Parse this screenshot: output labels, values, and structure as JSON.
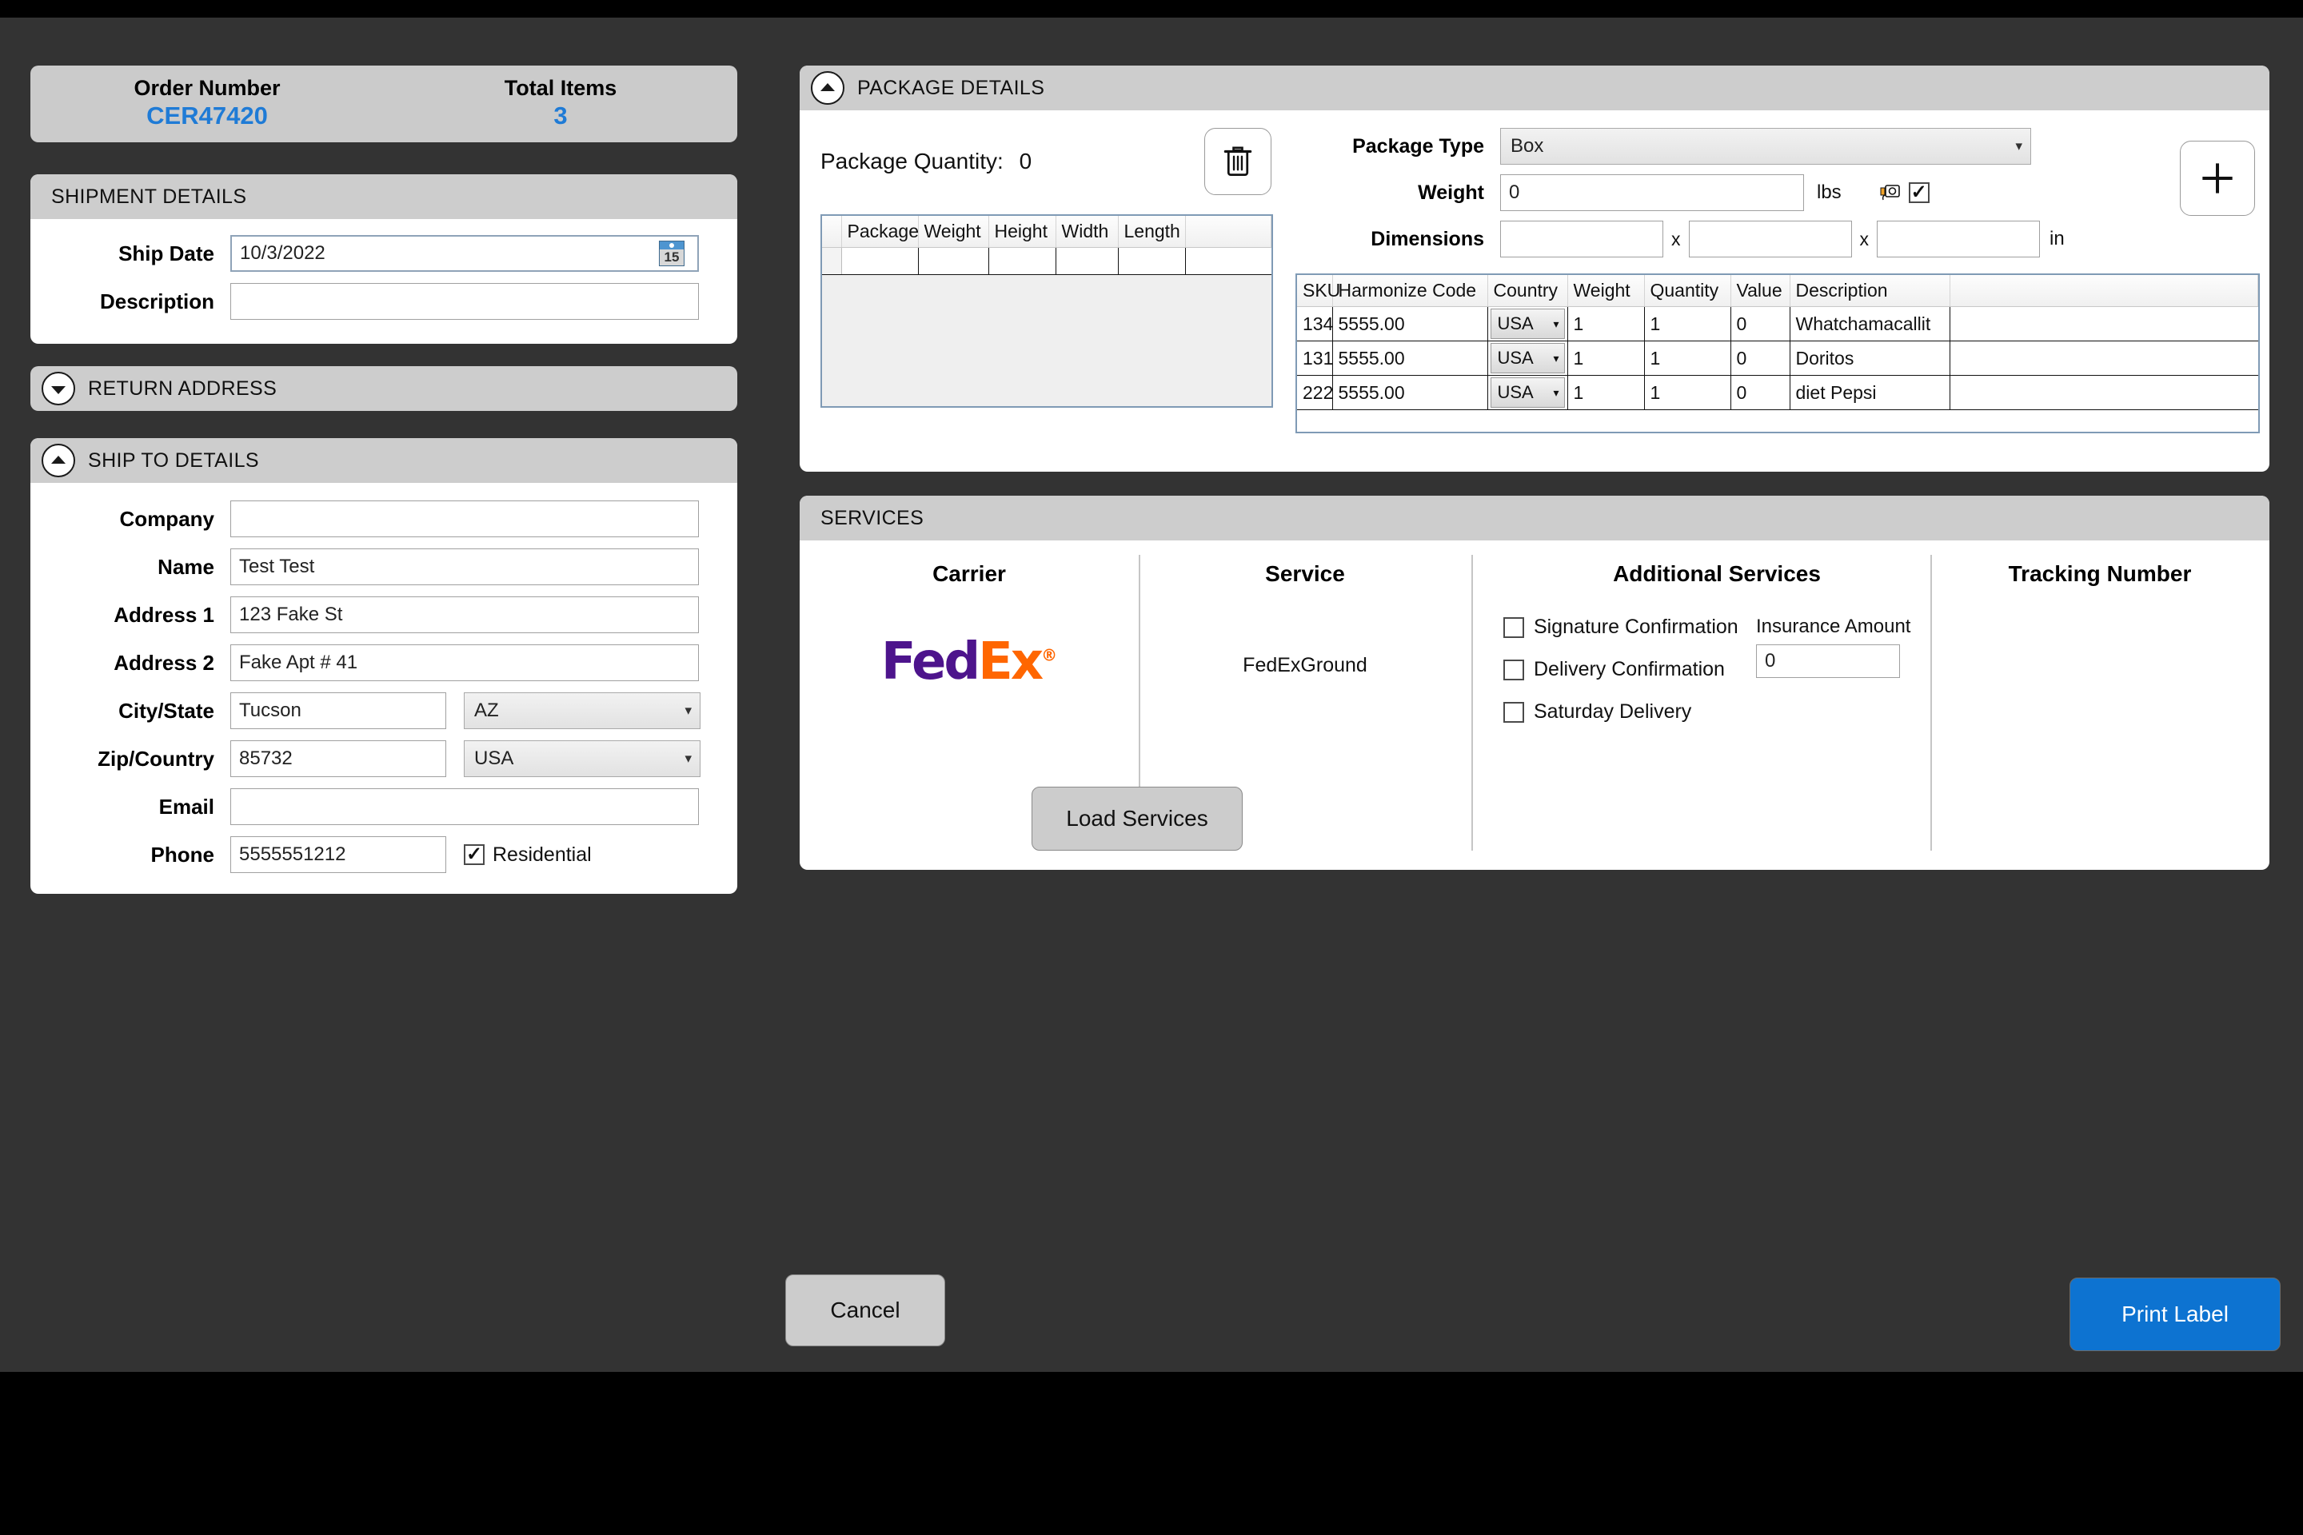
{
  "order_header": {
    "order_number_label": "Order Number",
    "order_number_value": "CER47420",
    "total_items_label": "Total Items",
    "total_items_value": "3",
    "accent_color": "#1f7bd6"
  },
  "shipment_details": {
    "title": "SHIPMENT DETAILS",
    "ship_date_label": "Ship Date",
    "ship_date_value": "10/3/2022",
    "calendar_day": "15",
    "description_label": "Description",
    "description_value": ""
  },
  "return_address": {
    "title": "RETURN ADDRESS",
    "collapsed": true
  },
  "ship_to": {
    "title": "SHIP TO DETAILS",
    "company_label": "Company",
    "company_value": "",
    "name_label": "Name",
    "name_value": "Test Test",
    "address1_label": "Address 1",
    "address1_value": "123 Fake St",
    "address2_label": "Address 2",
    "address2_value": "Fake Apt # 41",
    "city_state_label": "City/State",
    "city_value": "Tucson",
    "state_value": "AZ",
    "zip_country_label": "Zip/Country",
    "zip_value": "85732",
    "country_value": "USA",
    "email_label": "Email",
    "email_value": "",
    "phone_label": "Phone",
    "phone_value": "5555551212",
    "residential_label": "Residential",
    "residential_checked": true
  },
  "package_details": {
    "title": "PACKAGE DETAILS",
    "package_quantity_label": "Package Quantity:",
    "package_quantity_value": "0",
    "delete_icon": "trash-icon",
    "add_icon": "plus-icon",
    "package_table": {
      "columns": [
        "Package",
        "Weight",
        "Height",
        "Width",
        "Length",
        ""
      ],
      "rows": [
        [
          "",
          "",
          "",
          "",
          "",
          ""
        ]
      ]
    },
    "package_type_label": "Package Type",
    "package_type_value": "Box",
    "weight_label": "Weight",
    "weight_value": "0",
    "weight_unit": "lbs",
    "scale_icon": "scale-icon",
    "scale_checked": true,
    "dimensions_label": "Dimensions",
    "dim_length": "",
    "dim_width": "",
    "dim_height": "",
    "dim_separator": "x",
    "dim_unit": "in",
    "sku_table": {
      "columns": [
        "SKU",
        "Harmonize Code",
        "Country",
        "Weight",
        "Quantity",
        "Value",
        "Description",
        ""
      ],
      "rows": [
        {
          "sku": "134",
          "harmonize_code": "5555.00",
          "country": "USA",
          "weight": "1",
          "quantity": "1",
          "value": "0",
          "description": "Whatchamacallit",
          "extra": ""
        },
        {
          "sku": "131",
          "harmonize_code": "5555.00",
          "country": "USA",
          "weight": "1",
          "quantity": "1",
          "value": "0",
          "description": "Doritos",
          "extra": ""
        },
        {
          "sku": "222",
          "harmonize_code": "5555.00",
          "country": "USA",
          "weight": "1",
          "quantity": "1",
          "value": "0",
          "description": "diet Pepsi",
          "extra": ""
        }
      ]
    }
  },
  "services": {
    "title": "SERVICES",
    "carrier_header": "Carrier",
    "carrier_logo_fed": "Fed",
    "carrier_logo_ex": "Ex",
    "carrier_logo_reg": "®",
    "service_header": "Service",
    "service_value": "FedExGround",
    "additional_services_header": "Additional Services",
    "signature_confirmation_label": "Signature Confirmation",
    "signature_confirmation_checked": false,
    "delivery_confirmation_label": "Delivery Confirmation",
    "delivery_confirmation_checked": false,
    "saturday_delivery_label": "Saturday Delivery",
    "saturday_delivery_checked": false,
    "insurance_amount_label": "Insurance Amount",
    "insurance_amount_value": "0",
    "tracking_number_header": "Tracking Number",
    "tracking_number_value": "",
    "load_services_label": "Load Services",
    "fedex_purple": "#4D148C",
    "fedex_orange": "#FF6600"
  },
  "footer": {
    "cancel_label": "Cancel",
    "print_label": "Print Label",
    "print_color": "#0d73d1"
  }
}
